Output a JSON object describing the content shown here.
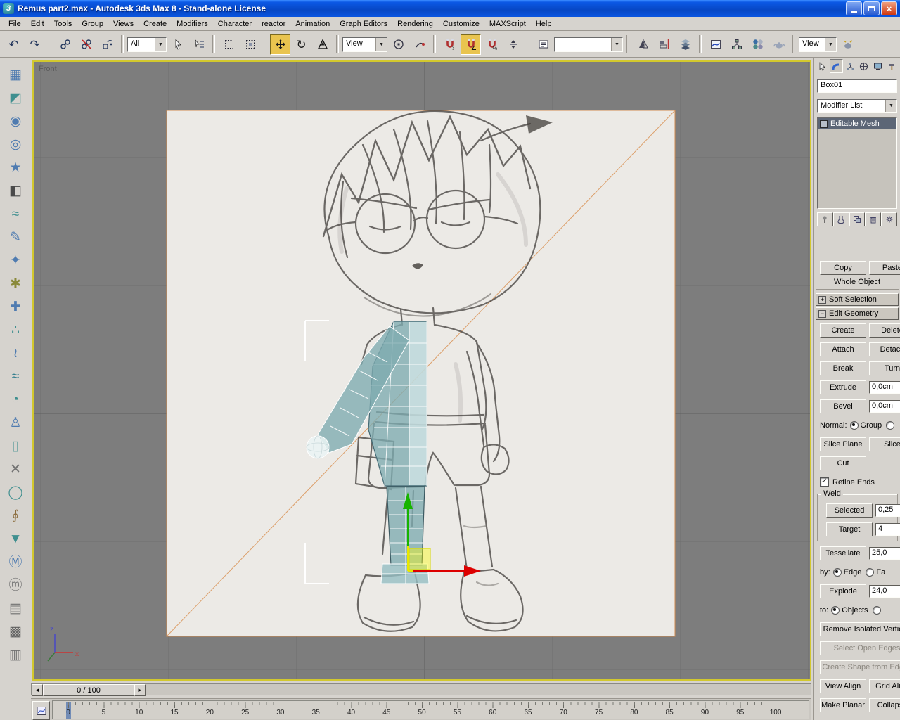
{
  "window": {
    "title": "Remus part2.max - Autodesk 3ds Max 8  - Stand-alone License"
  },
  "menu": {
    "items": [
      "File",
      "Edit",
      "Tools",
      "Group",
      "Views",
      "Create",
      "Modifiers",
      "Character",
      "reactor",
      "Animation",
      "Graph Editors",
      "Rendering",
      "Customize",
      "MAXScript",
      "Help"
    ]
  },
  "toolbar": {
    "selection_filter_value": "All",
    "coord_system_value": "View",
    "named_sets_value": "",
    "render_viewport_value": "View"
  },
  "viewport": {
    "label": "Front"
  },
  "left_toolbar": {
    "icons": [
      {
        "name": "cabinet-icon",
        "glyph": "▦",
        "color": "#4f7bb0"
      },
      {
        "name": "cloth-icon",
        "glyph": "◩",
        "color": "#3f8f8f"
      },
      {
        "name": "sphere-icon",
        "glyph": "◉",
        "color": "#4f7bb0"
      },
      {
        "name": "lamp-icon",
        "glyph": "◎",
        "color": "#4f7bb0"
      },
      {
        "name": "star-icon",
        "glyph": "★",
        "color": "#4f7bb0"
      },
      {
        "name": "gradient-icon",
        "glyph": "◧",
        "color": "#4a4a4a"
      },
      {
        "name": "springs-icon",
        "glyph": "≈",
        "color": "#3f8f8f"
      },
      {
        "name": "pencil-icon",
        "glyph": "✎",
        "color": "#4f7bb0"
      },
      {
        "name": "spark-icon",
        "glyph": "✦",
        "color": "#4f7bb0"
      },
      {
        "name": "gear-icon",
        "glyph": "✱",
        "color": "#8a8a3a"
      },
      {
        "name": "cross-icon",
        "glyph": "✚",
        "color": "#4f7bb0"
      },
      {
        "name": "spray-icon",
        "glyph": "∴",
        "color": "#3f8f8f"
      },
      {
        "name": "wave-icon",
        "glyph": "≀",
        "color": "#4f7bb0"
      },
      {
        "name": "ripple-icon",
        "glyph": "≈",
        "color": "#2e7b8c"
      },
      {
        "name": "quarter-sphere-icon",
        "glyph": "◔",
        "color": "#3f8f8f"
      },
      {
        "name": "figure-icon",
        "glyph": "♙",
        "color": "#4f7bb0"
      },
      {
        "name": "barrel-icon",
        "glyph": "▯",
        "color": "#3f8f8f"
      },
      {
        "name": "bones-icon",
        "glyph": "✕",
        "color": "#707070"
      },
      {
        "name": "ring-icon",
        "glyph": "◯",
        "color": "#3f8f8f"
      },
      {
        "name": "spiral-icon",
        "glyph": "∮",
        "color": "#8a6a3a"
      },
      {
        "name": "tshirt-icon",
        "glyph": "▼",
        "color": "#3f8f8f"
      },
      {
        "name": "metaball-icon",
        "glyph": "Ⓜ",
        "color": "#4f7bb0"
      },
      {
        "name": "metaball-gray-icon",
        "glyph": "ⓜ",
        "color": "#707070"
      },
      {
        "name": "stack-icon",
        "glyph": "▤",
        "color": "#707070"
      },
      {
        "name": "checker-icon",
        "glyph": "▩",
        "color": "#606060"
      },
      {
        "name": "panel-icon",
        "glyph": "▥",
        "color": "#707070"
      }
    ]
  },
  "command_panel": {
    "object_name_value": "Box01",
    "modifier_list_value": "Modifier List",
    "stack": {
      "items": [
        {
          "label": "Editable Mesh"
        }
      ]
    },
    "named_selection": {
      "copy_label": "Copy",
      "paste_label": "Paste"
    },
    "selection_status": "Whole Object",
    "rollout_soft_selection": "Soft Selection",
    "rollout_edit_geometry": "Edit Geometry",
    "edit_geometry": {
      "rows": [
        {
          "type": "btn2",
          "a": "Create",
          "b": "Delete"
        },
        {
          "type": "btn2",
          "a": "Attach",
          "b": "Detach"
        },
        {
          "type": "btn2",
          "a": "Break",
          "b": "Turn"
        },
        {
          "type": "btnspin",
          "a": "Extrude",
          "v": "0,0cm"
        },
        {
          "type": "btnspin",
          "a": "Bevel",
          "v": "0,0cm"
        },
        {
          "type": "radio",
          "label": "Normal:",
          "options": [
            {
              "t": "Group",
              "on": true
            },
            {
              "t": "",
              "on": false
            }
          ]
        },
        {
          "type": "btn2",
          "a": "Slice Plane",
          "b": "Slice"
        },
        {
          "type": "btn2",
          "a": "Cut",
          "b": ""
        },
        {
          "type": "check",
          "label": "Refine Ends",
          "checked": true
        },
        {
          "type": "groupbox",
          "label": "Weld",
          "rows": [
            {
              "type": "btnspin",
              "a": "Selected",
              "v": "0,25"
            },
            {
              "type": "btnspin",
              "a": "Target",
              "v": "4"
            }
          ]
        },
        {
          "type": "btnspin",
          "a": "Tessellate",
          "v": "25,0"
        },
        {
          "type": "radio",
          "label": "by:",
          "options": [
            {
              "t": "Edge",
              "on": true
            },
            {
              "t": "Fa",
              "on": false
            }
          ]
        },
        {
          "type": "btnspin",
          "a": "Explode",
          "v": "24,0"
        },
        {
          "type": "radio",
          "label": "to:",
          "options": [
            {
              "t": "Objects",
              "on": true
            },
            {
              "t": "",
              "on": false
            }
          ]
        },
        {
          "type": "btn1",
          "a": "Remove Isolated Vertices"
        },
        {
          "type": "btn1",
          "a": "Select Open Edges",
          "disabled": true
        },
        {
          "type": "btn1",
          "a": "Create Shape from Edges",
          "disabled": true
        },
        {
          "type": "btn2",
          "a": "View Align",
          "b": "Grid Align"
        },
        {
          "type": "btn2",
          "a": "Make Planar",
          "b": "Collapse"
        }
      ]
    }
  },
  "timeline": {
    "slider_value": "0 / 100",
    "ticks": [
      "0",
      "5",
      "10",
      "15",
      "20",
      "25",
      "30",
      "35",
      "40",
      "45",
      "50",
      "55",
      "60",
      "65",
      "70",
      "75",
      "80",
      "85",
      "90",
      "95",
      "100"
    ]
  },
  "colors": {
    "active_tool": "#e9c44f",
    "viewport_border": "#d2c82e",
    "viewport_bg": "#7d7d7d",
    "mesh_teal": "#7daaaf",
    "gizmo_x": "#dd0000",
    "gizmo_y": "#17b400",
    "gizmo_plane": "#e8e800",
    "titlebar_blue": "#0b58e4"
  }
}
